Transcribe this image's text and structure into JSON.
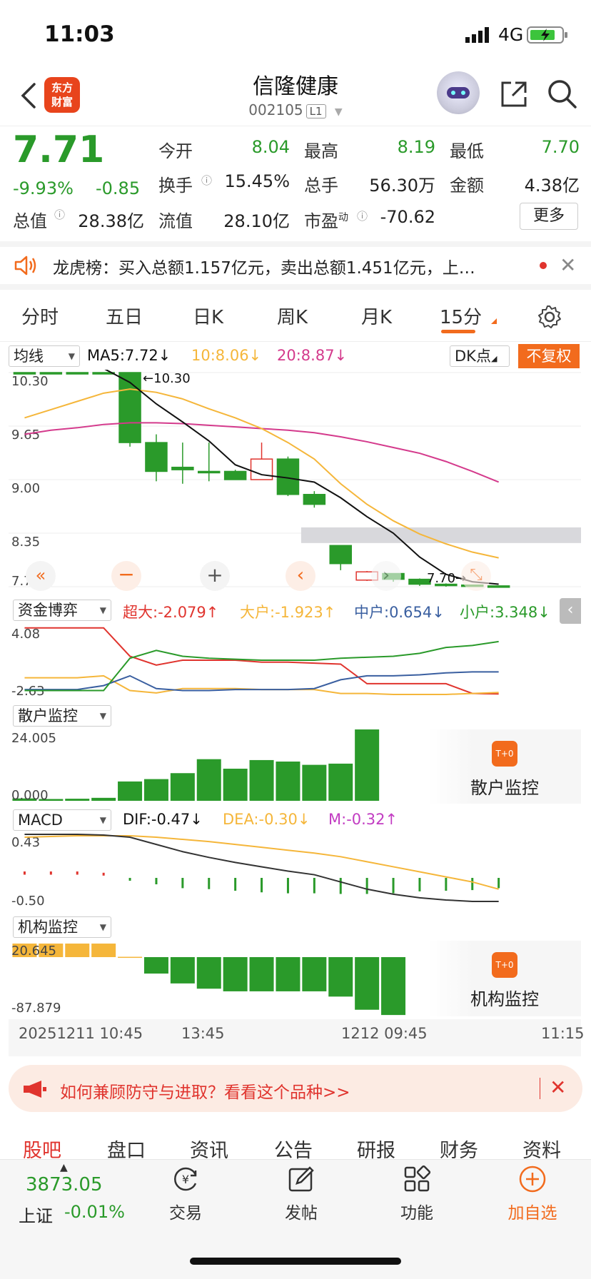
{
  "status_bar": {
    "time": "11:03",
    "network": "4G"
  },
  "nav": {
    "logo_line1": "东方",
    "logo_line2": "财富",
    "stock_name": "信隆健康",
    "stock_code": "002105",
    "level": "L1"
  },
  "quote": {
    "price": "7.71",
    "change_pct": "-9.93%",
    "change_amt": "-0.85",
    "fields": [
      {
        "label": "今开",
        "value": "8.04",
        "color": "#2a9a2a"
      },
      {
        "label": "最高",
        "value": "8.19",
        "color": "#2a9a2a"
      },
      {
        "label": "最低",
        "value": "7.70",
        "color": "#2a9a2a"
      },
      {
        "label": "换手",
        "value": "15.45%",
        "color": "#222222"
      },
      {
        "label": "总手",
        "value": "56.30万",
        "color": "#222222"
      },
      {
        "label": "金额",
        "value": "4.38亿",
        "color": "#222222"
      },
      {
        "label": "总值",
        "value": "28.38亿",
        "color": "#222222"
      },
      {
        "label": "流值",
        "value": "28.10亿",
        "color": "#222222"
      },
      {
        "label": "市盈",
        "value": "-70.62",
        "color": "#222222"
      }
    ],
    "pe_sup": "动",
    "more_label": "更多"
  },
  "notice": {
    "text": "龙虎榜：买入总额1.157亿元，卖出总额1.451亿元，上…"
  },
  "tabs": [
    "分时",
    "五日",
    "日K",
    "周K",
    "月K",
    "15分"
  ],
  "kline_header": {
    "selector": "均线",
    "ma5": "MA5:7.72↓",
    "ma10": "10:8.06↓",
    "ma20": "20:8.87↓",
    "dk": "DK点",
    "adjust": "不复权"
  },
  "chart_data": [
    {
      "type": "candlestick",
      "title": "",
      "y_ticks": [
        "10.30",
        "9.65",
        "9.00",
        "8.35",
        "7.70"
      ],
      "ylim": [
        7.7,
        10.3
      ],
      "high_label": "←10.30",
      "last_label": "7.70→",
      "candles": [
        {
          "o": 10.3,
          "c": 10.3,
          "h": 10.3,
          "l": 10.3
        },
        {
          "o": 10.3,
          "c": 10.3,
          "h": 10.3,
          "l": 10.3
        },
        {
          "o": 10.3,
          "c": 10.3,
          "h": 10.3,
          "l": 10.3
        },
        {
          "o": 10.3,
          "c": 10.3,
          "h": 10.3,
          "l": 10.3
        },
        {
          "o": 10.3,
          "c": 9.45,
          "h": 10.3,
          "l": 9.4
        },
        {
          "o": 9.45,
          "c": 9.1,
          "h": 9.55,
          "l": 8.98
        },
        {
          "o": 9.15,
          "c": 9.12,
          "h": 9.45,
          "l": 8.95
        },
        {
          "o": 9.1,
          "c": 9.1,
          "h": 9.45,
          "l": 8.98
        },
        {
          "o": 9.1,
          "c": 9.0,
          "h": 9.12,
          "l": 9.0
        },
        {
          "o": 9.0,
          "c": 9.25,
          "h": 9.45,
          "l": 9.0
        },
        {
          "o": 9.25,
          "c": 8.82,
          "h": 9.28,
          "l": 8.8
        },
        {
          "o": 8.82,
          "c": 8.7,
          "h": 8.86,
          "l": 8.66
        },
        {
          "o": 8.2,
          "c": 7.98,
          "h": 8.2,
          "l": 7.9
        },
        {
          "o": 7.78,
          "c": 7.88,
          "h": 7.89,
          "l": 7.77
        },
        {
          "o": 7.86,
          "c": 7.79,
          "h": 7.86,
          "l": 7.76
        },
        {
          "o": 7.79,
          "c": 7.73,
          "h": 7.8,
          "l": 7.71
        },
        {
          "o": 7.73,
          "c": 7.72,
          "h": 7.74,
          "l": 7.7
        },
        {
          "o": 7.72,
          "c": 7.71,
          "h": 7.72,
          "l": 7.7
        },
        {
          "o": 7.71,
          "c": 7.71,
          "h": 7.71,
          "l": 7.7
        }
      ],
      "ma5": [
        10.35,
        10.35,
        10.35,
        10.35,
        10.18,
        9.92,
        9.7,
        9.47,
        9.18,
        9.06,
        9.02,
        8.97,
        8.78,
        8.55,
        8.35,
        8.06,
        7.85,
        7.76,
        7.73
      ],
      "ma10": [
        9.75,
        9.85,
        9.95,
        10.05,
        10.1,
        10.06,
        9.98,
        9.86,
        9.75,
        9.62,
        9.45,
        9.25,
        8.95,
        8.7,
        8.5,
        8.34,
        8.22,
        8.12,
        8.05
      ],
      "ma20": [
        9.55,
        9.6,
        9.63,
        9.67,
        9.69,
        9.69,
        9.68,
        9.66,
        9.64,
        9.62,
        9.6,
        9.57,
        9.52,
        9.46,
        9.39,
        9.32,
        9.22,
        9.1,
        8.97
      ],
      "shaded_band": [
        8.23,
        8.42
      ]
    },
    {
      "type": "line",
      "title": "资金博弈",
      "y_ticks": [
        "4.08",
        "-2.63"
      ],
      "ylim": [
        -2.63,
        4.08
      ],
      "series": [
        {
          "name": "超大",
          "color": "#e0342e",
          "values": [
            4.1,
            4.1,
            4.1,
            4.1,
            1.2,
            0.3,
            0.8,
            0.8,
            0.8,
            0.6,
            0.6,
            0.5,
            0.4,
            -1.6,
            -1.6,
            -1.6,
            -1.6,
            -2.6,
            -2.65
          ]
        },
        {
          "name": "大户",
          "color": "#f5b63a",
          "values": [
            -1.0,
            -1.0,
            -1.0,
            -0.8,
            -2.3,
            -2.55,
            -2.1,
            -2.1,
            -2.1,
            -2.2,
            -2.2,
            -2.2,
            -2.6,
            -2.6,
            -2.7,
            -2.7,
            -2.7,
            -2.6,
            -2.5
          ]
        },
        {
          "name": "中户",
          "color": "#3a5fa0",
          "values": [
            -2.2,
            -2.2,
            -2.2,
            -1.8,
            -0.8,
            -2.1,
            -2.3,
            -2.3,
            -2.2,
            -2.2,
            -2.2,
            -2.1,
            -1.2,
            -0.8,
            -0.8,
            -0.7,
            -0.5,
            -0.4,
            -0.4
          ]
        },
        {
          "name": "小户",
          "color": "#2a9a2a",
          "values": [
            -2.3,
            -2.3,
            -2.3,
            -2.3,
            1.0,
            1.8,
            1.2,
            1.0,
            0.9,
            0.8,
            0.8,
            0.8,
            1.0,
            1.1,
            1.2,
            1.5,
            2.1,
            2.3,
            2.7
          ]
        }
      ],
      "header": {
        "chaoda": "超大:-2.079↑",
        "dahu": "大户:-1.923↑",
        "zhonghu": "中户:0.654↓",
        "xiaohu": "小户:3.348↓"
      }
    },
    {
      "type": "bar",
      "title": "散户监控",
      "y_ticks": [
        "24.005",
        "0.000"
      ],
      "ylim": [
        0,
        24.005
      ],
      "values": [
        0.8,
        0.6,
        0.7,
        1.0,
        6.5,
        7.3,
        9.3,
        14.0,
        10.8,
        13.7,
        13.2,
        12.1,
        12.5,
        24.0
      ]
    },
    {
      "type": "line",
      "title": "MACD",
      "y_ticks": [
        "0.43",
        "-0.50"
      ],
      "ylim": [
        -0.5,
        0.43
      ],
      "header": {
        "dif": "DIF:-0.47↓",
        "dea": "DEA:-0.30↓",
        "m": "M:-0.32↑"
      },
      "dif": [
        0.46,
        0.46,
        0.46,
        0.45,
        0.42,
        0.32,
        0.22,
        0.14,
        0.07,
        0.01,
        -0.05,
        -0.1,
        -0.2,
        -0.3,
        -0.37,
        -0.42,
        -0.45,
        -0.47,
        -0.47
      ],
      "dea": [
        0.42,
        0.43,
        0.44,
        0.44,
        0.44,
        0.42,
        0.39,
        0.36,
        0.32,
        0.28,
        0.24,
        0.2,
        0.15,
        0.08,
        0.01,
        -0.06,
        -0.13,
        -0.2,
        -0.3
      ],
      "m": [
        0.1,
        0.1,
        0.1,
        0.08,
        -0.05,
        -0.2,
        -0.32,
        -0.35,
        -0.4,
        -0.45,
        -0.48,
        -0.48,
        -0.5,
        -0.5,
        -0.48,
        -0.42,
        -0.4,
        -0.38,
        -0.32
      ]
    },
    {
      "type": "bar",
      "title": "机构监控",
      "y_ticks": [
        "20.645",
        "-87.879"
      ],
      "ylim": [
        -87.879,
        20.645
      ],
      "values": [
        20.6,
        20.6,
        20.6,
        20.6,
        0.5,
        -25,
        -40,
        -48,
        -52,
        -52,
        -52,
        -52,
        -60,
        -80,
        -88
      ]
    }
  ],
  "x_axis": {
    "labels": [
      "20251211 10:45",
      "13:45",
      "1212 09:45",
      "11:15"
    ]
  },
  "chart_colors": {
    "green": "#2a9a2a",
    "red": "#e0342e",
    "ma5": "#111111",
    "ma10": "#f5b63a",
    "ma20": "#d43a8c",
    "orange": "#f26b1d"
  },
  "side_cards": {
    "sanhu": "散户监控",
    "jigou": "机构监控",
    "icon_text": "T+0"
  },
  "ad": {
    "text": "如何兼顾防守与进取？看看这个品种>>"
  },
  "bottom_tabs": [
    "股吧",
    "盘口",
    "资讯",
    "公告",
    "研报",
    "财务",
    "资料"
  ],
  "bottom_bar": {
    "index_value": "3873.05",
    "index_name": "上证",
    "index_change": "-0.01%",
    "items": [
      "交易",
      "发帖",
      "功能",
      "加自选"
    ]
  }
}
